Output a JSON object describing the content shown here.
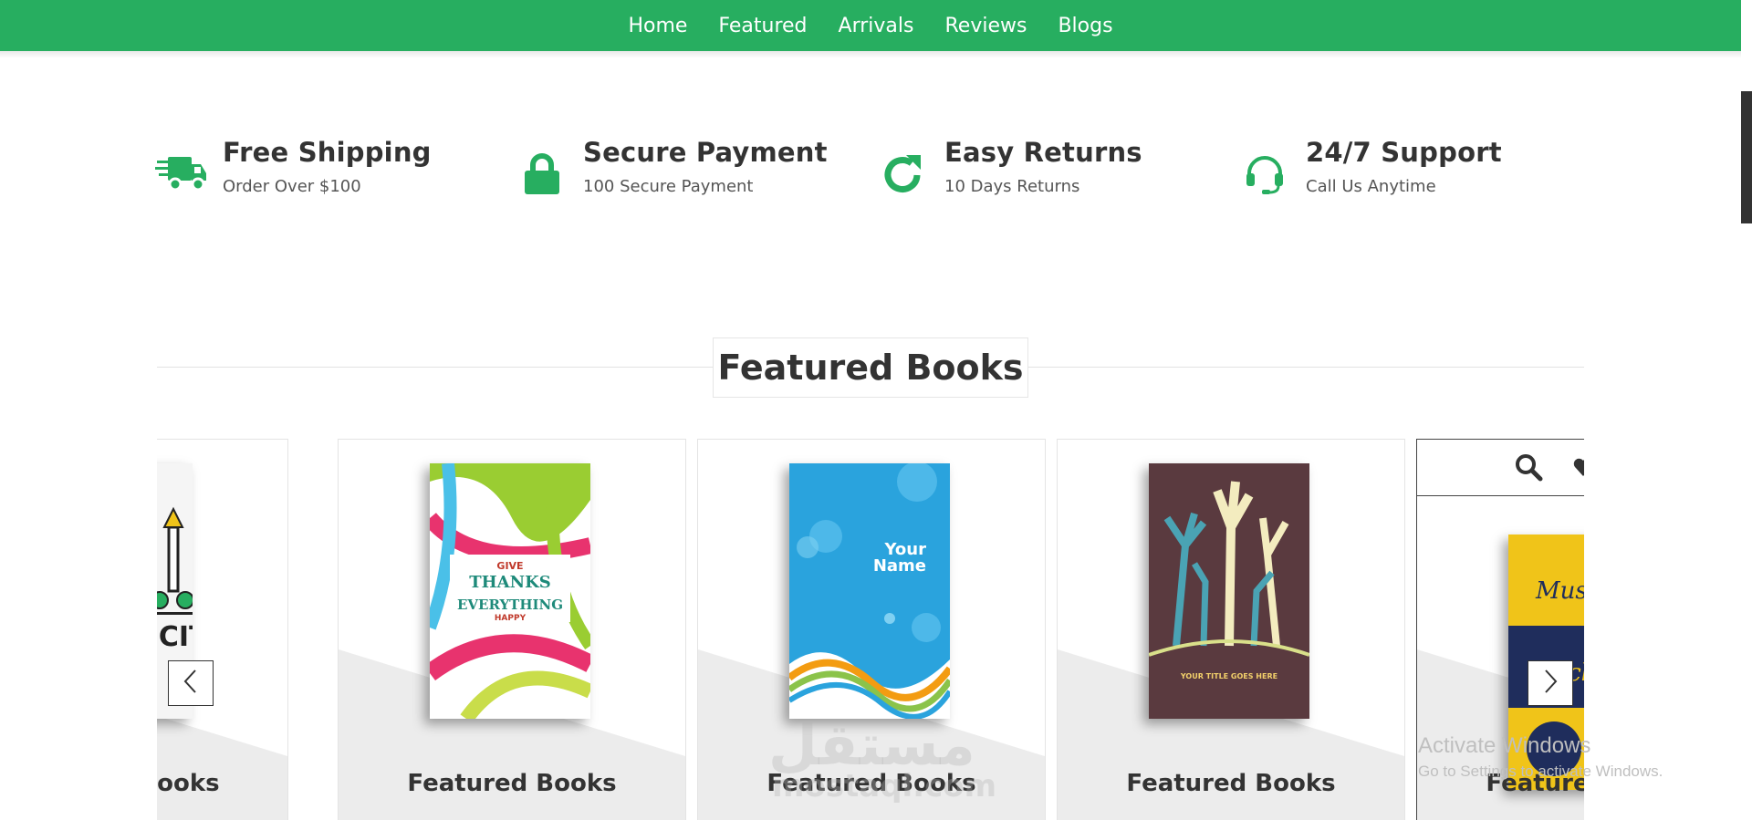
{
  "nav": {
    "items": [
      {
        "label": "Home"
      },
      {
        "label": "Featured"
      },
      {
        "label": "Arrivals"
      },
      {
        "label": "Reviews"
      },
      {
        "label": "Blogs"
      }
    ]
  },
  "icons": [
    {
      "icon": "truck-icon",
      "title": "Free Shipping",
      "subtitle": "Order Over $100"
    },
    {
      "icon": "lock-icon",
      "title": "Secure Payment",
      "subtitle": "100 Secure Payment"
    },
    {
      "icon": "redo-icon",
      "title": "Easy Returns",
      "subtitle": "10 Days Returns"
    },
    {
      "icon": "headset-icon",
      "title": "24/7 Support",
      "subtitle": "Call Us Anytime"
    }
  ],
  "featured": {
    "heading": "Featured Books",
    "cards": [
      {
        "caption": "Featured Books",
        "cover_text": "T CITY"
      },
      {
        "caption": "Featured Books",
        "cover_text": "GIVE THANKS IN EVERYTHING HAPPY"
      },
      {
        "caption": "Featured Books",
        "cover_text": "Your Name"
      },
      {
        "caption": "Featured Books",
        "cover_text": "YOUR TITLE GOES HERE"
      },
      {
        "caption": "Featured Books",
        "cover_text": "Music Rock"
      }
    ]
  },
  "os_watermark": {
    "line1": "Activate Windows",
    "line2": "Go to Settings to activate Windows."
  },
  "site_watermark": {
    "arabic": "مستقل",
    "latin": "mostaql.com"
  },
  "colors": {
    "accent": "#27ae60",
    "text": "#333333"
  }
}
